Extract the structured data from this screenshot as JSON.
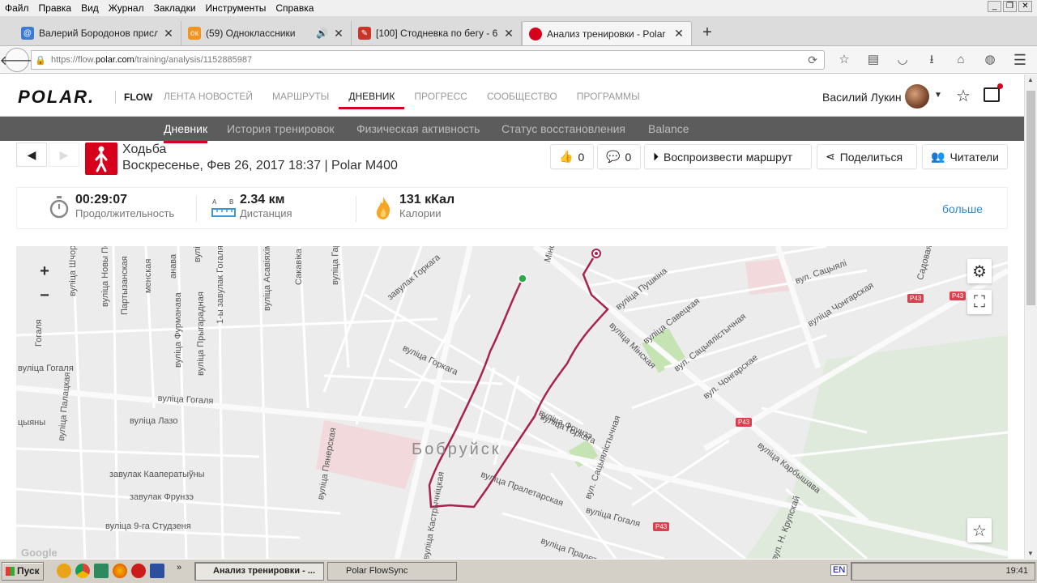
{
  "browser": {
    "menu": [
      "Файл",
      "Правка",
      "Вид",
      "Журнал",
      "Закладки",
      "Инструменты",
      "Справка"
    ],
    "tabs": [
      {
        "title": "Валерий Бородонов присл...",
        "color": "#3b7bd0",
        "glyph": "@"
      },
      {
        "title": "(59) Одноклассники",
        "color": "#f39322",
        "glyph": "ok"
      },
      {
        "title": "[100] Стодневка по бегу - 6...",
        "color": "#c8362a",
        "glyph": "✎"
      },
      {
        "title": "Анализ тренировки - Polar F...",
        "color": "#d6001c",
        "glyph": ""
      }
    ],
    "url_prefix": "https://flow.",
    "url_domain": "polar.com",
    "url_path": "/training/analysis/1152885987"
  },
  "polar": {
    "logo": "POLAR.",
    "flow": "FLOW",
    "nav": [
      "ЛЕНТА НОВОСТЕЙ",
      "МАРШРУТЫ",
      "ДНЕВНИК",
      "ПРОГРЕСС",
      "СООБЩЕСТВО",
      "ПРОГРАММЫ"
    ],
    "user_name": "Василий Лукин",
    "subnav": [
      "Дневник",
      "История тренировок",
      "Физическая активность",
      "Статус восстановления",
      "Balance"
    ]
  },
  "activity": {
    "sport": "Ходьба",
    "datetime": "Воскресенье, Фев 26, 2017 18:37 | Polar M400",
    "likes": "0",
    "comments": "0",
    "replay": "Воспроизвести маршрут",
    "share": "Поделиться",
    "readers": "Читатели"
  },
  "summary": {
    "duration": "00:29:07",
    "duration_label": "Продолжительность",
    "distance": "2.34 км",
    "distance_label": "Дистанция",
    "calories": "131 кКал",
    "calories_label": "Калории",
    "more": "больше"
  },
  "map": {
    "city": "Бобруйск",
    "streets": [
      "вуліца Шчорса",
      "вуліца Новы Побыт",
      "Партызанская",
      "менская",
      "анава",
      "вуліца Р. Люксембург",
      "вуліца Асавіяхіма",
      "Сакавіка",
      "вуліца Гарка",
      "завулак Горкага",
      "вуліца Горкага",
      "вуліца Пушкіна",
      "вуліца Савецкая",
      "вул. Сацыялістычная",
      "вуліца Мінская",
      "вул. Чонгарскае",
      "вул. Сацыялі",
      "вуліца Чонгарская",
      "Садовая",
      "вуліца Гогаля",
      "вуліца Лазо",
      "завулак Кааператыўны",
      "завулак Фрунзэ",
      "вуліца 9-га Студзеня",
      "вуліца Пянерская",
      "вуліца Кастрычніцкая",
      "вул. Сацыялістычная",
      "вуліца Карбышава",
      "вуліца Пралет",
      "вул. Н. Крупскай",
      "вуліца Палацкая",
      "вуліца Фрунзэ",
      "вуліца Пралетарская",
      "Мінска",
      "1-ы завулак Гогаля",
      "вуліца Прыгарадная",
      "вуліца Фурманава",
      "Гогаля",
      "цыяны",
      "вуліца Гогаля",
      "вуліца Гогаля",
      "вуліца Горкага"
    ],
    "road": "P43",
    "google": "Google"
  },
  "taskbar": {
    "start": "Пуск",
    "tasks": [
      "Анализ тренировки - ...",
      "Polar FlowSync"
    ],
    "lang": "EN",
    "clock": "19:41"
  }
}
